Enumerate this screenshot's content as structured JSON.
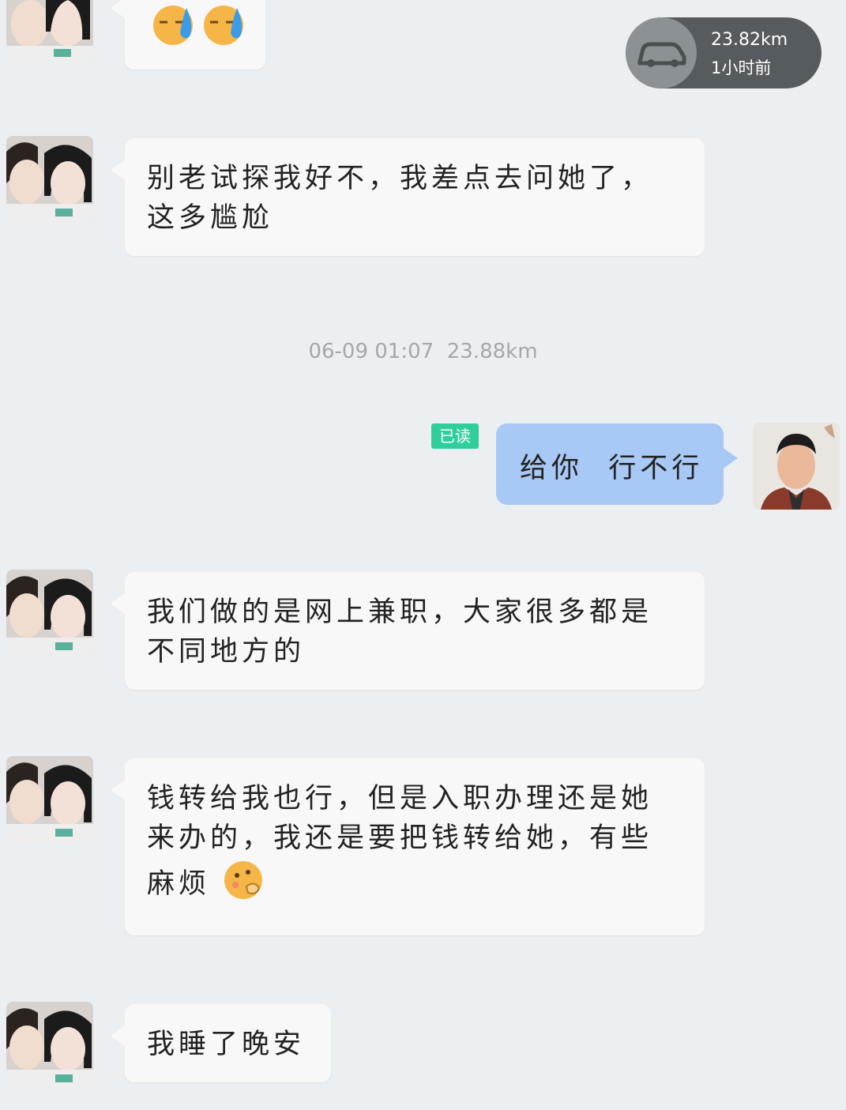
{
  "location_card": {
    "distance": "23.82km",
    "time_ago": "1小时前",
    "icon": "car-icon"
  },
  "timestamp": {
    "date_time": "06-09 01:07",
    "distance": "23.88km"
  },
  "read_badge": "已读",
  "messages": [
    {
      "text": ""
    },
    {
      "text": "别老试探我好不，我差点去问她了，这多尴尬"
    },
    {
      "text": "给你  行不行"
    },
    {
      "text": "我们做的是网上兼职，大家很多都是不同地方的"
    },
    {
      "text": "钱转给我也行，但是入职办理还是她来办的，我还是要把钱转给她，有些麻烦"
    },
    {
      "text": "我睡了晚安"
    }
  ],
  "colors": {
    "background": "#eceff1",
    "incoming_bubble": "#f8f8f8",
    "outgoing_bubble": "#a8c8f5",
    "read_badge": "#2fcf9b"
  }
}
